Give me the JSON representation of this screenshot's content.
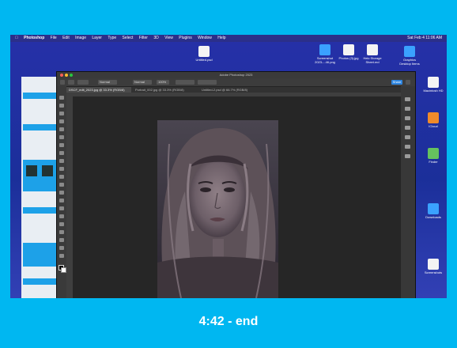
{
  "caption": "4:42 - end",
  "desktop": {
    "menubar": {
      "app": "Photoshop",
      "items": [
        "File",
        "Edit",
        "Image",
        "Layer",
        "Type",
        "Select",
        "Filter",
        "3D",
        "View",
        "Plugins",
        "Window",
        "Help"
      ],
      "clock": "Sat Feb 4  11:06 AM"
    },
    "icons": [
      {
        "label": "Untitled.psd",
        "icon": "file-icon"
      },
      {
        "label": "Screenshot 2023-...46.png",
        "icon": "screenshot-icon"
      },
      {
        "label": "Photos (3).jpg",
        "icon": "photo-file-icon"
      },
      {
        "label": "Heic Storage Sheet.md",
        "icon": "document-icon"
      },
      {
        "label": "Graphics Desktop Items",
        "icon": "folder-icon"
      },
      {
        "label": "Macintosh HD",
        "icon": "drive-icon"
      },
      {
        "label": "ICloud",
        "icon": "cloud-icon"
      },
      {
        "label": "Finder",
        "icon": "finder-icon"
      },
      {
        "label": "Downloads",
        "icon": "downloads-folder-icon"
      },
      {
        "label": "Screenshots",
        "icon": "screenshots-folder-icon"
      }
    ]
  },
  "photoshop": {
    "window_title": "Adobe Photoshop 2023",
    "tabs": [
      "DSCF_edit_2023.jpg @ 33.3% (RGB/8)",
      "Portrait_002.jpg @ 33.3% (RGB/8)",
      "Untitled-2.psd @ 66.7% (RGB/8)"
    ],
    "options_bar": {
      "mode": "Normal",
      "style": "Normal",
      "opacity": "100%"
    },
    "share_label": "Share"
  }
}
